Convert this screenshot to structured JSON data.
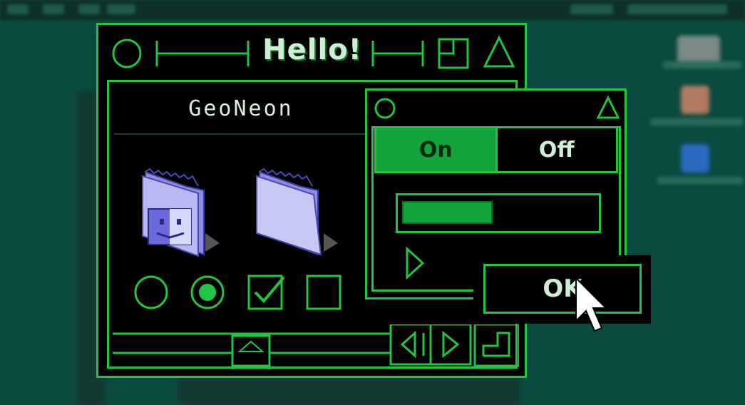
{
  "window": {
    "title": "Hello!",
    "subtitle": "GeoNeon"
  },
  "folders": [
    {
      "name": "finder-folder-icon"
    },
    {
      "name": "blank-folder-icon"
    }
  ],
  "controls": {
    "radio_unselected": false,
    "radio_selected": true,
    "checkbox_checked": true,
    "checkbox_unchecked": false
  },
  "panel": {
    "segment_on_label": "On",
    "segment_off_label": "Off",
    "selected_segment": "On",
    "progress": 0.47,
    "ok_label": "OK"
  },
  "colors": {
    "accent": "#22c541",
    "fill": "#12a33a",
    "background": "#000000",
    "desktop": "#0b4a3f"
  }
}
